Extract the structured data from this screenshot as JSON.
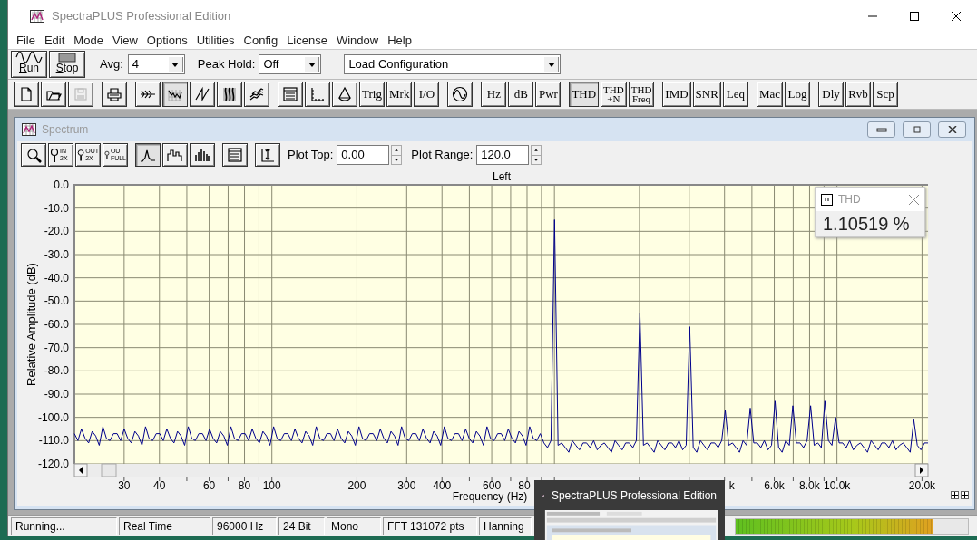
{
  "window": {
    "title": "SpectraPLUS Professional Edition"
  },
  "menu": [
    "File",
    "Edit",
    "Mode",
    "View",
    "Options",
    "Utilities",
    "Config",
    "License",
    "Window",
    "Help"
  ],
  "toolbar": {
    "run": "Run",
    "stop": "Stop",
    "avg": {
      "label": "Avg:",
      "value": "4"
    },
    "peak_hold": {
      "label": "Peak Hold:",
      "value": "Off"
    },
    "configuration": {
      "value": "Load Configuration"
    }
  },
  "analysis_toolbar": [
    [
      {
        "kind": "icon",
        "selected": false
      },
      {
        "kind": "icon",
        "selected": false
      },
      {
        "kind": "icon",
        "selected": false,
        "disabled": true
      }
    ],
    [
      {
        "kind": "icon",
        "selected": false
      }
    ],
    [
      {
        "kind": "icon",
        "selected": false
      },
      {
        "kind": "icon",
        "selected": true
      },
      {
        "kind": "icon",
        "selected": false
      },
      {
        "kind": "icon",
        "selected": false
      },
      {
        "kind": "icon",
        "selected": false
      }
    ],
    [
      {
        "kind": "icon",
        "selected": false
      },
      {
        "kind": "icon",
        "selected": false
      },
      {
        "kind": "icon",
        "selected": false
      },
      {
        "kind": "text",
        "lines": [
          "Trig"
        ],
        "selected": false
      },
      {
        "kind": "text",
        "lines": [
          "Mrk"
        ],
        "selected": false
      },
      {
        "kind": "text",
        "lines": [
          "I/O"
        ],
        "selected": false
      }
    ],
    [
      {
        "kind": "icon",
        "selected": false
      }
    ],
    [
      {
        "kind": "text",
        "lines": [
          "Hz"
        ],
        "selected": false
      },
      {
        "kind": "text",
        "lines": [
          "dB"
        ],
        "selected": false
      },
      {
        "kind": "text",
        "lines": [
          "Pwr"
        ],
        "selected": false
      }
    ],
    [
      {
        "kind": "text",
        "lines": [
          "THD"
        ],
        "selected": true
      },
      {
        "kind": "text",
        "lines": [
          "THD",
          "+N"
        ],
        "selected": false
      },
      {
        "kind": "text",
        "lines": [
          "THD",
          "Freq"
        ],
        "selected": false
      }
    ],
    [
      {
        "kind": "text",
        "lines": [
          "IMD"
        ],
        "selected": false
      },
      {
        "kind": "text",
        "lines": [
          "SNR"
        ],
        "selected": false
      },
      {
        "kind": "text",
        "lines": [
          "Leq"
        ],
        "selected": false
      }
    ],
    [
      {
        "kind": "text",
        "lines": [
          "Mac"
        ],
        "selected": false
      },
      {
        "kind": "text",
        "lines": [
          "Log"
        ],
        "selected": false
      }
    ],
    [
      {
        "kind": "text",
        "lines": [
          "Dly"
        ],
        "selected": false
      },
      {
        "kind": "text",
        "lines": [
          "Rvb"
        ],
        "selected": false
      },
      {
        "kind": "text",
        "lines": [
          "Scp"
        ],
        "selected": false
      }
    ]
  ],
  "spectrum": {
    "title": "Spectrum",
    "zoom_tools": [
      {
        "kind": "icon"
      },
      {
        "kind": "zoom",
        "top": "IN",
        "bottom": "2X"
      },
      {
        "kind": "zoom",
        "top": "OUT",
        "bottom": "2X"
      },
      {
        "kind": "zoom",
        "top": "OUT",
        "bottom": "FULL"
      }
    ],
    "view_modes": [
      {
        "selected": true
      },
      {
        "selected": false
      },
      {
        "selected": false
      }
    ],
    "plot_top": {
      "label": "Plot Top:",
      "value": "0.00"
    },
    "plot_range": {
      "label": "Plot Range:",
      "value": "120.0"
    },
    "chart_data": {
      "type": "line",
      "xlabel": "Frequency (Hz)",
      "ylabel": "Relative Amplitude (dB)",
      "grid": true,
      "ylim": [
        -120,
        0
      ],
      "yticks": [
        {
          "value": 0,
          "label": "0.0"
        },
        {
          "value": -10,
          "label": "-10.0"
        },
        {
          "value": -20,
          "label": "-20.0"
        },
        {
          "value": -30,
          "label": "-30.0"
        },
        {
          "value": -40,
          "label": "-40.0"
        },
        {
          "value": -50,
          "label": "-50.0"
        },
        {
          "value": -60,
          "label": "-60.0"
        },
        {
          "value": -70,
          "label": "-70.0"
        },
        {
          "value": -80,
          "label": "-80.0"
        },
        {
          "value": -90,
          "label": "-90.0"
        },
        {
          "value": -100,
          "label": "-100.0"
        },
        {
          "value": -110,
          "label": "-110.0"
        },
        {
          "value": -120,
          "label": "-120.0"
        }
      ],
      "series": [
        {
          "name": "Left",
          "color": "#00008b",
          "values": [
            -107,
            -110,
            -105,
            -109,
            -111,
            -106,
            -108,
            -112,
            -104,
            -109,
            -110,
            -107,
            -107,
            -110,
            -105,
            -109,
            -111,
            -106,
            -108,
            -112,
            -104,
            -109,
            -110,
            -107,
            -107,
            -110,
            -105,
            -109,
            -111,
            -106,
            -108,
            -112,
            -104,
            -109,
            -110,
            -107,
            -107,
            -110,
            -105,
            -109,
            -111,
            -106,
            -108,
            -112,
            -104,
            -109,
            -110,
            -107,
            -107,
            -110,
            -105,
            -109,
            -111,
            -106,
            -108,
            -112,
            -104,
            -109,
            -110,
            -107,
            -107,
            -110,
            -105,
            -109,
            -111,
            -106,
            -108,
            -112,
            -104,
            -109,
            -110,
            -107,
            -107,
            -110,
            -105,
            -109,
            -111,
            -106,
            -108,
            -112,
            -104,
            -109,
            -110,
            -107,
            -107,
            -110,
            -105,
            -109,
            -111,
            -106,
            -108,
            -112,
            -104,
            -109,
            -110,
            -107,
            -107,
            -110,
            -105,
            -109,
            -111,
            -106,
            -108,
            -112,
            -104,
            -109,
            -110,
            -107,
            -107,
            -110,
            -105,
            -109,
            -111,
            -106,
            -108,
            -112,
            -104,
            -109,
            -110,
            -107,
            -107,
            -110,
            -105,
            -109,
            -111,
            -106,
            -108,
            -112,
            -104,
            -109,
            -110,
            -107,
            -111,
            -113,
            -110,
            -15,
            -112,
            -111,
            -113,
            -115,
            -110,
            -112,
            -114,
            -111,
            -111,
            -113,
            -110,
            -114,
            -112,
            -111,
            -113,
            -115,
            -110,
            -112,
            -114,
            -111,
            -111,
            -113,
            -110,
            -55,
            -112,
            -111,
            -113,
            -115,
            -110,
            -112,
            -114,
            -111,
            -111,
            -113,
            -110,
            -114,
            -112,
            -61,
            -113,
            -115,
            -110,
            -112,
            -114,
            -111,
            -111,
            -113,
            -110,
            -97,
            -112,
            -111,
            -113,
            -115,
            -110,
            -112,
            -96,
            -111,
            -111,
            -113,
            -110,
            -114,
            -112,
            -93,
            -113,
            -115,
            -110,
            -112,
            -95,
            -111,
            -111,
            -113,
            -110,
            -95,
            -112,
            -111,
            -113,
            -93,
            -110,
            -112,
            -100,
            -111,
            -111,
            -113,
            -110,
            -114,
            -112,
            -111,
            -113,
            -115,
            -110,
            -112,
            -114,
            -111,
            -111,
            -113,
            -110,
            -114,
            -112,
            -111,
            -113,
            -115,
            -101,
            -112,
            -114,
            -111,
            -111
          ]
        }
      ]
    },
    "frequency_labels": [
      "30",
      "40",
      "60",
      "80",
      "100",
      "200",
      "300",
      "400",
      "600",
      "80",
      "k",
      "6.0k",
      "8.0k",
      "10.0k",
      "20.0k"
    ],
    "thd": {
      "title": "THD",
      "value": "1.10519 %"
    }
  },
  "status_bar": {
    "fields": [
      "Running...",
      "Real Time",
      "96000 Hz",
      "24 Bit",
      "Mono",
      "FFT 131072 pts",
      "Hanning"
    ],
    "meter": {
      "level": 0.85
    }
  },
  "taskbar_preview": {
    "title": "SpectraPLUS Professional Edition",
    "kind": "picture"
  }
}
